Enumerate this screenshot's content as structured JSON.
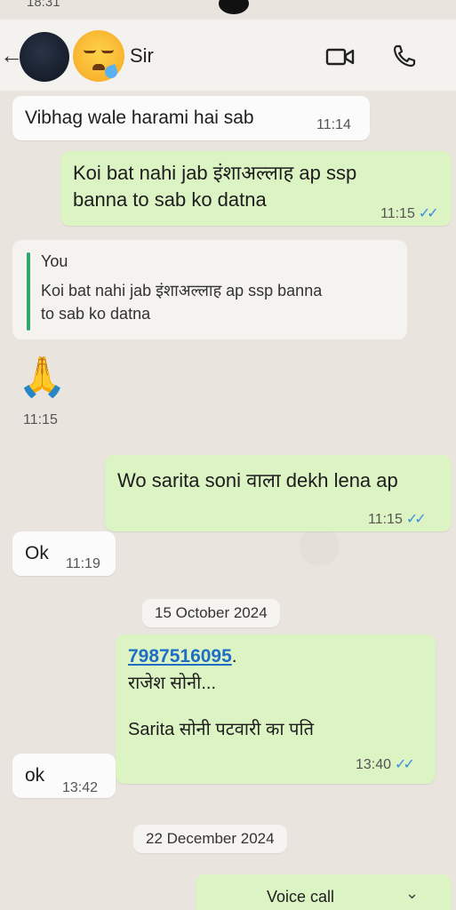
{
  "status": {
    "time": "18:31"
  },
  "header": {
    "contact_name": "Sir"
  },
  "messages": {
    "m1": {
      "text": "Vibhag wale harami hai sab",
      "time": "11:14"
    },
    "m2": {
      "line1": "Koi bat nahi jab इंशाअल्लाह ap ssp",
      "line2": "banna to sab ko datna",
      "time": "11:15",
      "ticks": "✓✓"
    },
    "m3": {
      "quote_name": "You",
      "quote_line1": "Koi bat nahi jab इंशाअल्लाह ap ssp banna",
      "quote_line2": "to sab ko datna",
      "time": "11:15"
    },
    "m4": {
      "text": "Wo sarita soni वाला dekh lena ap",
      "time": "11:15",
      "ticks": "✓✓"
    },
    "m5": {
      "text": "Ok",
      "time": "11:19"
    },
    "date1": "15 October 2024",
    "m6": {
      "phone": "7987516095",
      "line2": "राजेश सोनी...",
      "line3": "Sarita सोनी पटवारी का पति",
      "time": "13:40",
      "ticks": "✓✓"
    },
    "m7": {
      "text": "ok",
      "time": "13:42"
    },
    "date2": "22 December 2024",
    "m8": {
      "text": "Voice call"
    }
  }
}
